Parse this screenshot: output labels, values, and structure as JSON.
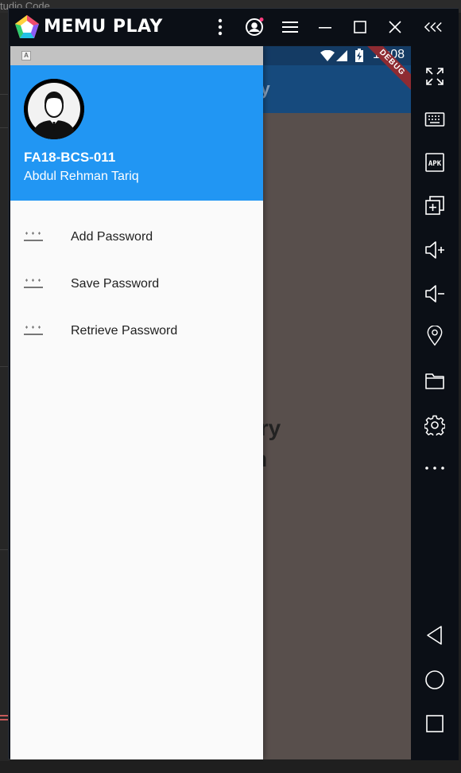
{
  "background_window": {
    "title_fragment": "tudio Code"
  },
  "emulator": {
    "brand_name": "MEMU PLAY",
    "accent_colors": {
      "play_triangle": "#1e90ff",
      "notification_dot": "#ff3d7f"
    },
    "titlebar_icons": [
      "more-vertical-icon",
      "account-icon",
      "hamburger-menu-icon",
      "minimize-icon",
      "maximize-icon",
      "close-icon",
      "collapse-sidebar-icon"
    ],
    "toolbar_icons": [
      "fullscreen-icon",
      "keyboard-icon",
      "apk-icon",
      "multi-instance-icon",
      "volume-up-icon",
      "volume-down-icon",
      "location-icon",
      "folder-icon",
      "settings-icon",
      "more-horizontal-icon",
      "back-nav-icon",
      "home-nav-icon",
      "recents-nav-icon"
    ],
    "apk_label": "APK"
  },
  "android": {
    "status_time": "10:08",
    "debug_banner": "DEBUG",
    "appbar_title_partial": "ry",
    "body_text_partial_1": "iry",
    "body_text_partial_2": "n"
  },
  "drawer": {
    "notification_glyph": "A",
    "user_id": "FA18-BCS-011",
    "user_name": "Abdul Rehman Tariq",
    "header_color": "#2196f3",
    "items": [
      {
        "label": "Add Password",
        "icon": "password-icon"
      },
      {
        "label": "Save Password",
        "icon": "password-icon"
      },
      {
        "label": "Retrieve Password",
        "icon": "password-icon"
      }
    ]
  }
}
